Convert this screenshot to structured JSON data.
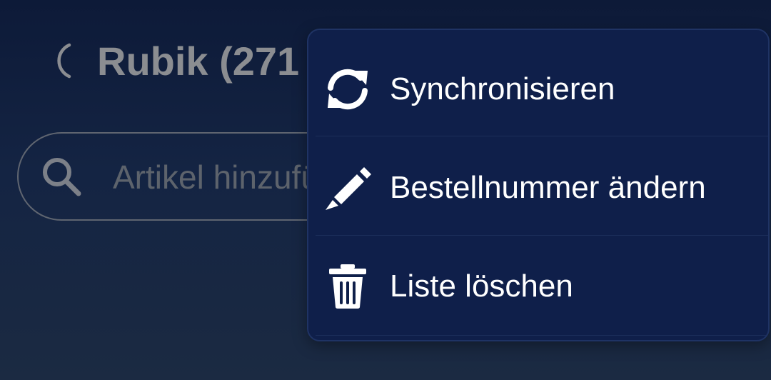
{
  "header": {
    "title": "Rubik (271"
  },
  "search": {
    "placeholder": "Artikel hinzufügen"
  },
  "menu": {
    "items": [
      {
        "label": "Synchronisieren",
        "icon": "sync-icon"
      },
      {
        "label": "Bestellnummer ändern",
        "icon": "pencil-icon"
      },
      {
        "label": "Liste löschen",
        "icon": "trash-icon"
      }
    ]
  },
  "colors": {
    "background_top": "#0d1a38",
    "background_bottom": "#1b2a42",
    "menu_background": "#0f1f4a",
    "menu_text": "#ffffff",
    "dimmed_text": "#8b8d91"
  }
}
